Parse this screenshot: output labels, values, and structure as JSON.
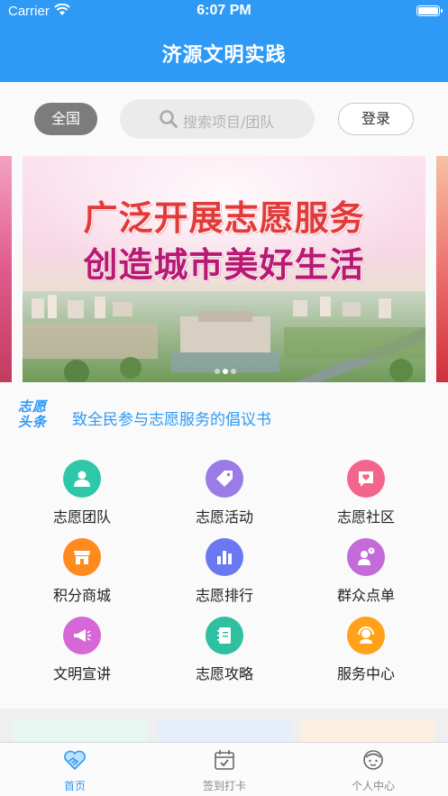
{
  "status_bar": {
    "carrier": "Carrier",
    "time": "6:07 PM"
  },
  "header": {
    "title": "济源文明实践"
  },
  "search": {
    "region": "全国",
    "placeholder": "搜索项目/团队",
    "login": "登录"
  },
  "banner": {
    "line1": "广泛开展志愿服务",
    "line2": "创造城市美好生活",
    "slide_count": 3,
    "active_slide": 2
  },
  "headline": {
    "tag_line1": "志愿",
    "tag_line2": "头条",
    "text": "致全民参与志愿服务的倡议书"
  },
  "menu": [
    {
      "label": "志愿团队",
      "icon": "team-icon",
      "color": "#2ec7a8"
    },
    {
      "label": "志愿活动",
      "icon": "tag-icon",
      "color": "#9b7be8"
    },
    {
      "label": "志愿社区",
      "icon": "heart-chat-icon",
      "color": "#f2668e"
    },
    {
      "label": "积分商城",
      "icon": "store-icon",
      "color": "#ff8a1f"
    },
    {
      "label": "志愿排行",
      "icon": "ranking-icon",
      "color": "#6a78f2"
    },
    {
      "label": "群众点单",
      "icon": "user-question-icon",
      "color": "#c46bdb"
    },
    {
      "label": "文明宣讲",
      "icon": "megaphone-icon",
      "color": "#d667d6"
    },
    {
      "label": "志愿攻略",
      "icon": "notebook-icon",
      "color": "#2ec0a0"
    },
    {
      "label": "服务中心",
      "icon": "headset-icon",
      "color": "#ffa21a"
    }
  ],
  "tabs": [
    {
      "label": "首页",
      "icon": "handshake-heart-icon",
      "active": true
    },
    {
      "label": "签到打卡",
      "icon": "calendar-check-icon",
      "active": false
    },
    {
      "label": "个人中心",
      "icon": "profile-icon",
      "active": false
    }
  ],
  "colors": {
    "primary": "#2e9af5",
    "tab_active": "#2e9af5",
    "tab_inactive": "#888888"
  }
}
